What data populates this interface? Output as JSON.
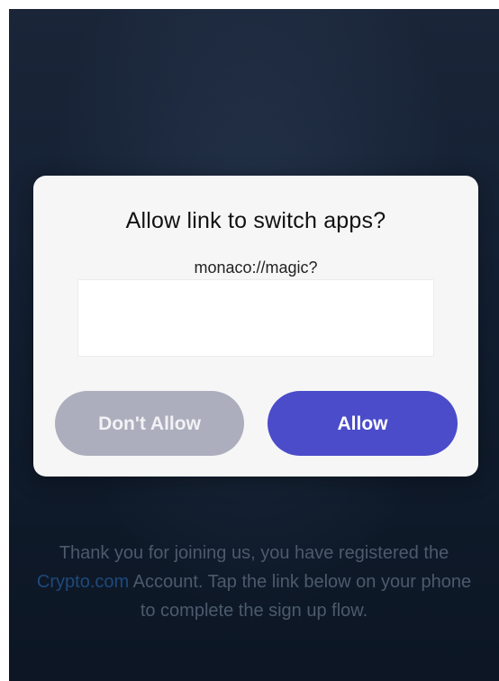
{
  "dialog": {
    "title": "Allow link to switch apps?",
    "url": "monaco://magic?",
    "deny_label": "Don't Allow",
    "allow_label": "Allow"
  },
  "message": {
    "part1": "Thank you for joining us, you have registered the ",
    "link_text": "Crypto.com",
    "part2": " Account. Tap the link below on your phone to complete the sign up flow."
  },
  "colors": {
    "allow_button": "#4b4cca",
    "deny_button": "#acaebd",
    "background": "#142033",
    "link": "#1e4a7c"
  }
}
